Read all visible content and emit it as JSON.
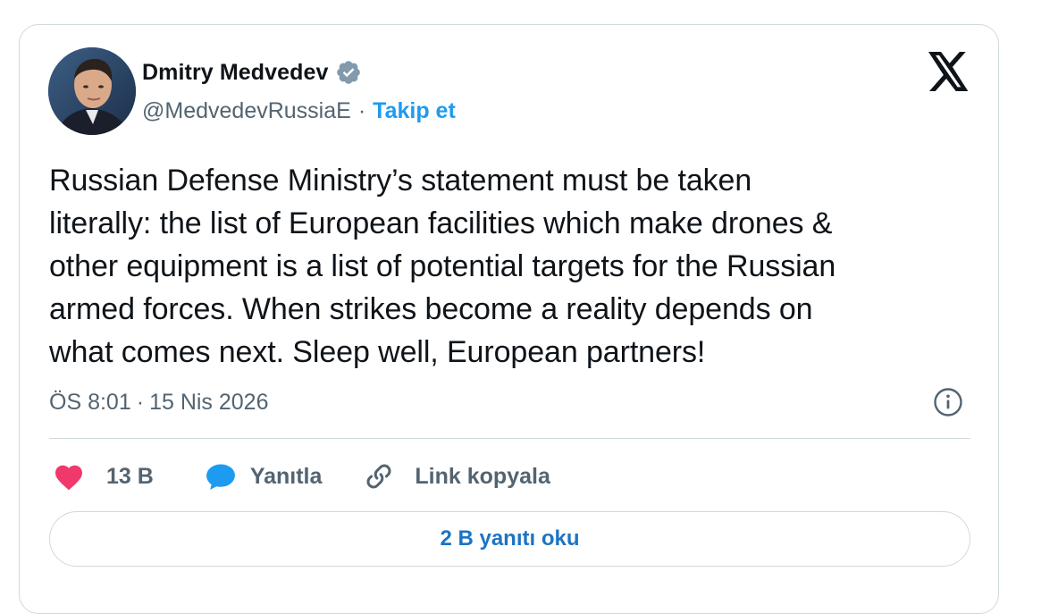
{
  "author": {
    "display_name": "Dmitry Medvedev",
    "handle": "@MedvedevRussiaE",
    "separator": "·",
    "follow_label": "Takip et",
    "verified_icon": "verified-badge-icon",
    "verified_color": "#829aab"
  },
  "tweet": {
    "text": "Russian Defense Ministry’s statement must be taken\nliterally: the list of European facilities which make drones &\nother equipment is a list of potential targets for the Russian\narmed forces. When strikes become a reality depends on\nwhat comes next. Sleep well, European partners!",
    "time": "ÖS 8:01",
    "separator": "·",
    "date": "15 Nis 2026"
  },
  "actions": {
    "like_count": "13 B",
    "reply_label": "Yanıtla",
    "copy_link_label": "Link kopyala"
  },
  "read_replies_label": "2 B yanıtı oku",
  "colors": {
    "accent": "#1d9bf0",
    "like": "#f91880",
    "reply_bubble": "#1d9bf0",
    "muted": "#536471",
    "border": "#cfd9de"
  }
}
